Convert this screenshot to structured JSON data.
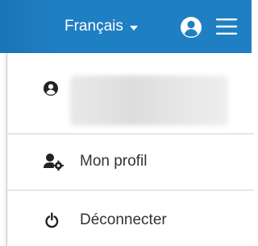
{
  "colors": {
    "topbar": "#1f7fc3",
    "icon_dark": "#222222",
    "text": "#333333"
  },
  "header": {
    "language_label": "Français",
    "user_icon": "user-circle-icon",
    "menu_icon": "hamburger-icon"
  },
  "user_menu": {
    "account_icon": "user-circle-icon",
    "items": [
      {
        "label": "Mon profil",
        "icon": "user-gear-icon"
      },
      {
        "label": "Déconnecter",
        "icon": "power-icon"
      }
    ]
  }
}
